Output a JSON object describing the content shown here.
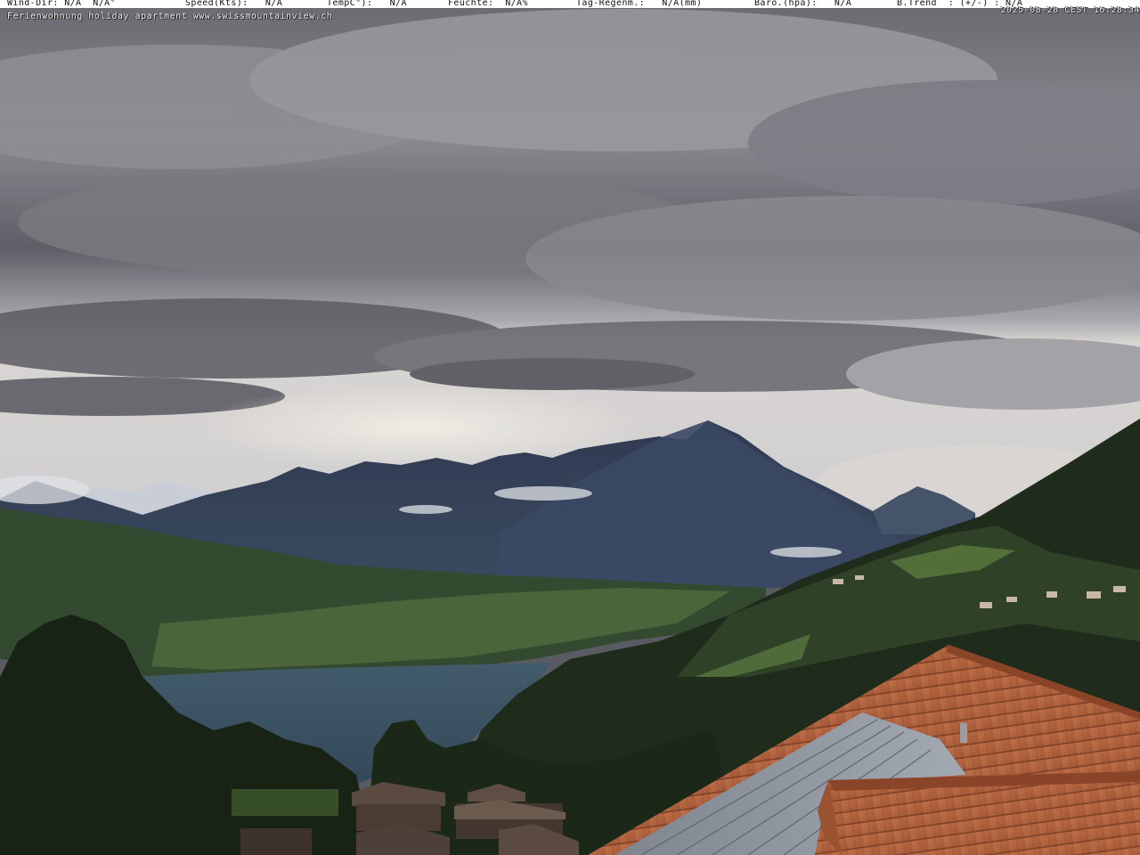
{
  "weather_bar": {
    "wind_dir": "Wind-Dir: N/A  N/A°",
    "speed": "Speed(Kts):   N/A",
    "temp": "TempC°):   N/A",
    "feuchte": "Feuchte:  N/A%",
    "tag_regen": "Tag-Regenm.:   N/A(mm)",
    "baro": "Baro.(hpa):   N/A",
    "trend": "B.Trend  : (+/-) : N/A"
  },
  "caption": "Ferienwohnung holiday apartment www.swissmountainview.ch",
  "timestamp": "2025-08-28 CEST 16:28:34",
  "colors": {
    "sky_dark": "#5b5a62",
    "sky_light": "#c8c6cc",
    "mountain": "#3a4660",
    "lake": "#3b5462",
    "forest": "#1e2a1a",
    "roof_tile": "#b3623d",
    "solar_panel": "#8a9099"
  },
  "scene_elements": [
    "cloudy-sky",
    "niesen-mountain",
    "mountain-range",
    "snowy-alps",
    "lake-thun",
    "forested-hillside",
    "village-houses",
    "tiled-roof",
    "solar-panels"
  ]
}
